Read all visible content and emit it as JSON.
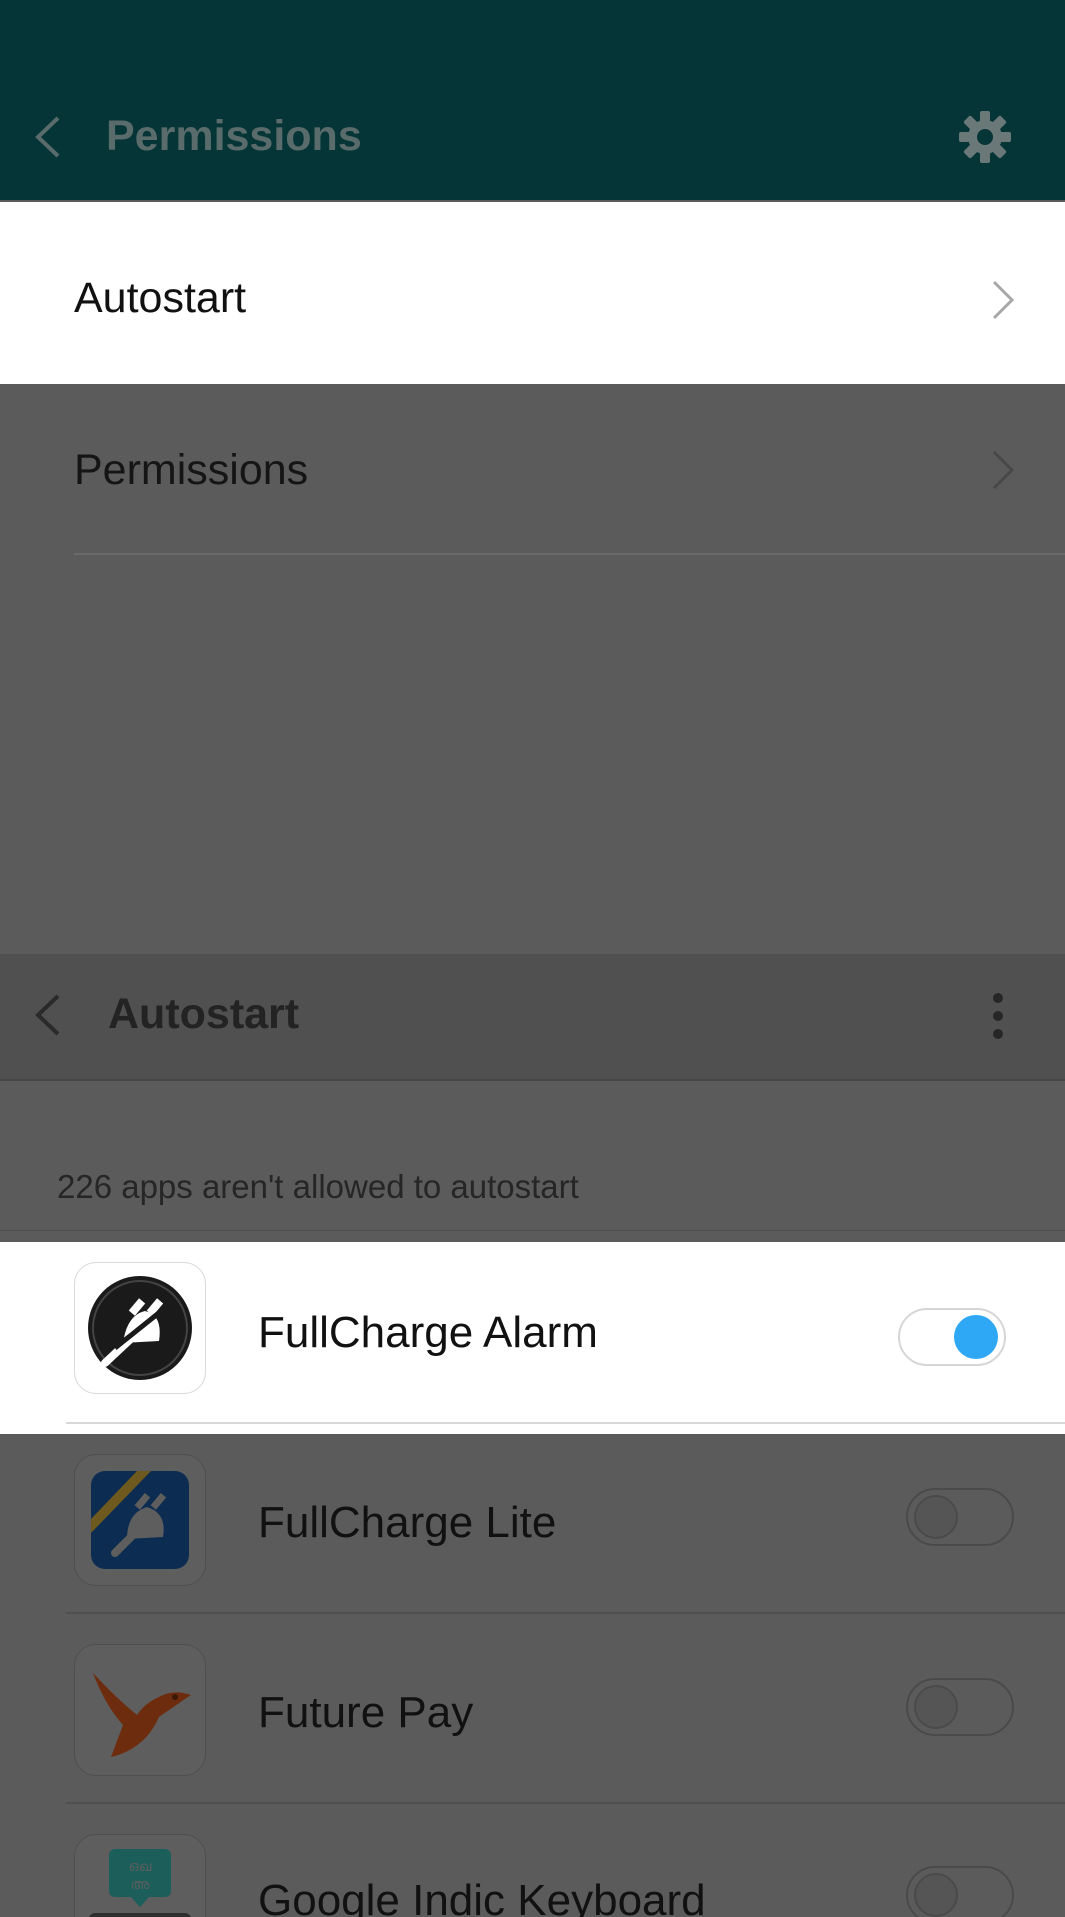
{
  "header": {
    "title": "Permissions"
  },
  "autostart_item": {
    "label": "Autostart"
  },
  "permissions_item": {
    "label": "Permissions"
  },
  "sub_toolbar": {
    "title": "Autostart"
  },
  "status": {
    "count_text": "226 apps aren't allowed to autostart"
  },
  "apps": [
    {
      "name": "FullCharge Alarm",
      "autostart_on": true
    },
    {
      "name": "FullCharge Lite",
      "autostart_on": false
    },
    {
      "name": "Future Pay",
      "autostart_on": false
    },
    {
      "name": "Google Indic Keyboard",
      "autostart_on": false
    }
  ],
  "colors": {
    "header_bg": "#053536",
    "toggle_on": "#2ea8f5",
    "overlay": "#5b5b5b"
  }
}
